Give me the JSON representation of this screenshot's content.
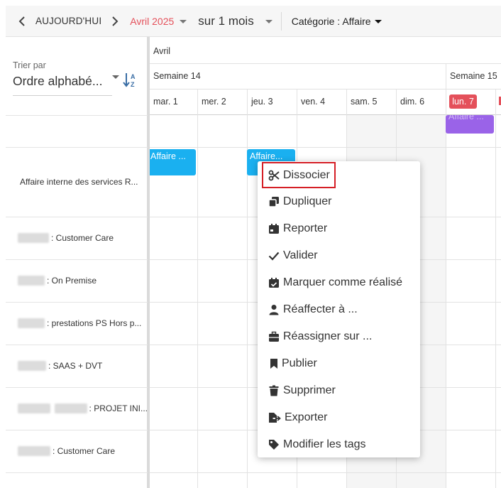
{
  "toolbar": {
    "today_label": "AUJOURD'HUI",
    "month_label": "Avril 2025",
    "duration_label": "sur 1 mois",
    "category_label": "Catégorie : Affaire"
  },
  "sidebar": {
    "sort_label": "Trier par",
    "sort_value": "Ordre alphabé...",
    "rows": [
      {
        "label": "Affaire interne des services R...",
        "blur_widths": []
      },
      {
        "label": ": Customer Care",
        "blur_widths": [
          44
        ]
      },
      {
        "label": ": On Premise",
        "blur_widths": [
          38
        ]
      },
      {
        "label": ": prestations PS Hors p...",
        "blur_widths": [
          38
        ]
      },
      {
        "label": ": SAAS + DVT",
        "blur_widths": [
          40
        ]
      },
      {
        "label": ": PROJET INI...",
        "blur_widths": [
          46,
          46
        ]
      },
      {
        "label": ": Customer Care",
        "blur_widths": [
          46
        ]
      }
    ]
  },
  "calendar": {
    "month_header": "Avril",
    "weeks": [
      "Semaine 14",
      "Semaine 15"
    ],
    "days": [
      "mar. 1",
      "mer. 2",
      "jeu. 3",
      "ven. 4",
      "sam. 5",
      "dim. 6",
      "lun. 7"
    ],
    "today_badge": "lun. 7",
    "events": {
      "top_purple": "Affaire ...",
      "row1_a": "Affaire ...",
      "row1_b": "Affaire..."
    },
    "colors": {
      "event_blue": "#1ab0f0",
      "event_purple": "#9a63e8",
      "today_red": "#e4505a"
    }
  },
  "context_menu": {
    "items": [
      {
        "label": "Dissocier",
        "icon": "scissors-icon"
      },
      {
        "label": "Dupliquer",
        "icon": "copy-icon"
      },
      {
        "label": "Reporter",
        "icon": "calendar-icon"
      },
      {
        "label": "Valider",
        "icon": "check-icon"
      },
      {
        "label": "Marquer comme réalisé",
        "icon": "calendar-check-icon"
      },
      {
        "label": "Réaffecter à ...",
        "icon": "user-icon"
      },
      {
        "label": "Réassigner sur ...",
        "icon": "briefcase-icon"
      },
      {
        "label": "Publier",
        "icon": "bookmark-icon"
      },
      {
        "label": "Supprimer",
        "icon": "trash-icon"
      },
      {
        "label": "Exporter",
        "icon": "export-file-icon"
      },
      {
        "label": "Modifier les tags",
        "icon": "tag-icon"
      }
    ],
    "highlight_color": "#d51f26"
  }
}
